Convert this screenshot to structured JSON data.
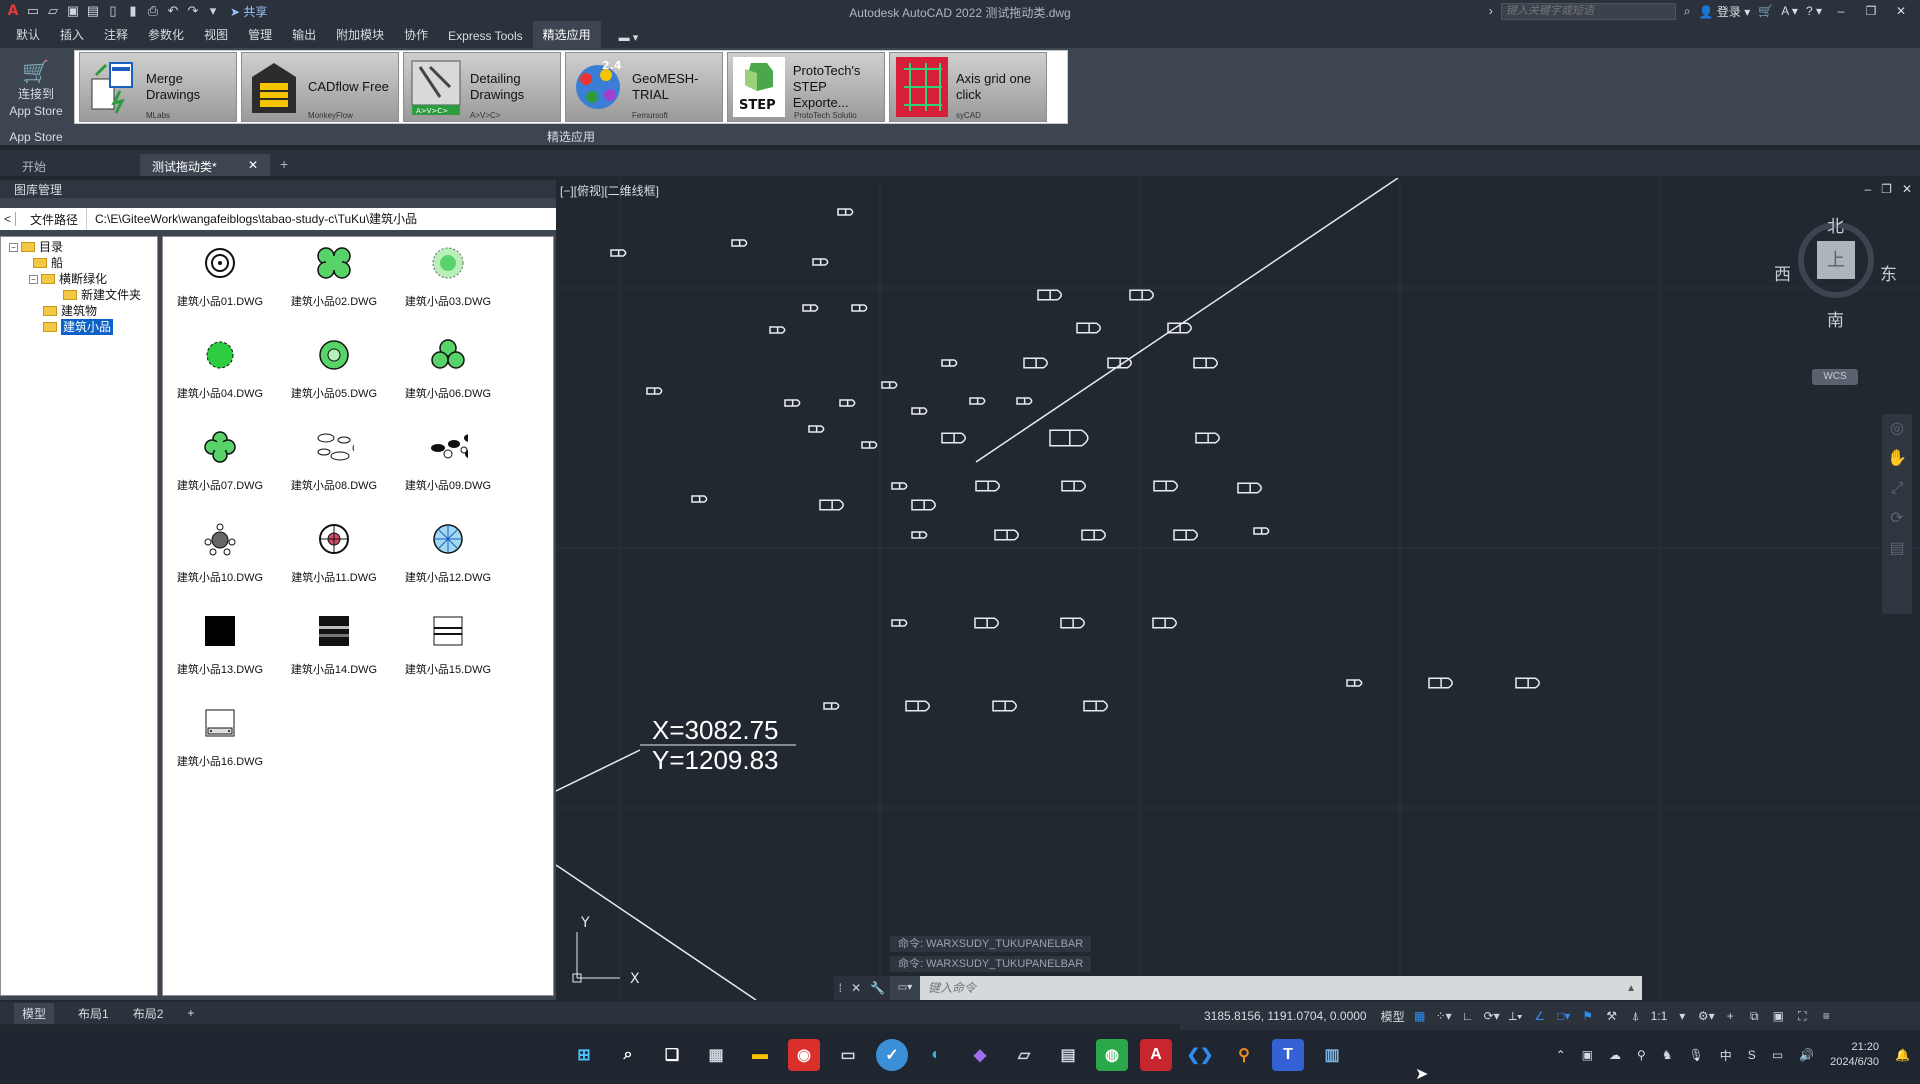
{
  "titlebar": {
    "app_logo": "A",
    "share_label": "共享",
    "title": "Autodesk AutoCAD 2022    测试拖动类.dwg",
    "search_placeholder": "键入关键字或短语",
    "login_label": "登录",
    "help_icon": "?"
  },
  "ribbon_tabs": [
    {
      "label": "默认"
    },
    {
      "label": "插入"
    },
    {
      "label": "注释"
    },
    {
      "label": "参数化"
    },
    {
      "label": "视图"
    },
    {
      "label": "管理"
    },
    {
      "label": "输出"
    },
    {
      "label": "附加模块"
    },
    {
      "label": "协作"
    },
    {
      "label": "Express Tools"
    },
    {
      "label": "精选应用"
    }
  ],
  "appstore": {
    "line1": "连接到",
    "line2": "App Store",
    "group_label": "App Store"
  },
  "featured_apps": [
    {
      "line1": "Merge",
      "line2": "Drawings",
      "vendor": "MLabs"
    },
    {
      "line1": "CADflow Free",
      "line2": "",
      "vendor": "MonkeyFlow"
    },
    {
      "line1": "Detailing",
      "line2": "Drawings",
      "vendor": "A>V>C>"
    },
    {
      "line1": "GeoMESH-",
      "line2": "TRIAL",
      "vendor": "Femursoft"
    },
    {
      "line1": "ProtoTech's",
      "line2": "STEP Exporte...",
      "vendor": "ProtoTech Solutio"
    },
    {
      "line1": "Axis grid one",
      "line2": "click",
      "vendor": "syCAD"
    }
  ],
  "featured_group_label": "精选应用",
  "file_tabs": {
    "start": "开始",
    "active": "测试拖动类*",
    "close": "✕",
    "add": "+"
  },
  "palette": {
    "title": "图库管理",
    "back": "<",
    "path_label": "文件路径",
    "path_value": "C:\\E\\GiteeWork\\wangafeiblogs\\tabao-study-c\\TuKu\\建筑小品",
    "tree": [
      {
        "label": "目录",
        "level": 0,
        "expander": "−"
      },
      {
        "label": "船",
        "level": 1,
        "expander": ""
      },
      {
        "label": "横断绿化",
        "level": 1,
        "expander": "−"
      },
      {
        "label": "新建文件夹",
        "level": 2,
        "expander": ""
      },
      {
        "label": "建筑物",
        "level": 1,
        "expander": ""
      },
      {
        "label": "建筑小品",
        "level": 1,
        "expander": "",
        "selected": true
      }
    ],
    "thumbs": [
      {
        "label": "建筑小品01.DWG"
      },
      {
        "label": "建筑小品02.DWG"
      },
      {
        "label": "建筑小品03.DWG"
      },
      {
        "label": "建筑小品04.DWG"
      },
      {
        "label": "建筑小品05.DWG"
      },
      {
        "label": "建筑小品06.DWG"
      },
      {
        "label": "建筑小品07.DWG"
      },
      {
        "label": "建筑小品08.DWG"
      },
      {
        "label": "建筑小品09.DWG"
      },
      {
        "label": "建筑小品10.DWG"
      },
      {
        "label": "建筑小品11.DWG"
      },
      {
        "label": "建筑小品12.DWG"
      },
      {
        "label": "建筑小品13.DWG"
      },
      {
        "label": "建筑小品14.DWG"
      },
      {
        "label": "建筑小品15.DWG"
      },
      {
        "label": "建筑小品16.DWG"
      }
    ]
  },
  "canvas": {
    "viewport_label": "[−][俯视][二维线框]",
    "coord_x": "X=3082.75",
    "coord_y": "Y=1209.83",
    "ucs_x": "X",
    "ucs_y": "Y"
  },
  "viewcube": {
    "north": "北",
    "south": "南",
    "east": "东",
    "west": "西",
    "face": "上",
    "wcs": "WCS"
  },
  "command": {
    "history": [
      "命令: WARXSUDY_TUKUPANELBAR",
      "命令:  WARXSUDY_TUKUPANELBAR"
    ],
    "placeholder": "键入命令"
  },
  "layout_tabs": [
    {
      "label": "模型"
    },
    {
      "label": "布局1"
    },
    {
      "label": "布局2"
    },
    {
      "label": "+"
    }
  ],
  "status": {
    "coords": "3185.8156, 1191.0704, 0.0000",
    "space": "模型",
    "scale": "1:1"
  },
  "tray": {
    "ime": "中",
    "time": "21:20",
    "date": "2024/6/30"
  }
}
